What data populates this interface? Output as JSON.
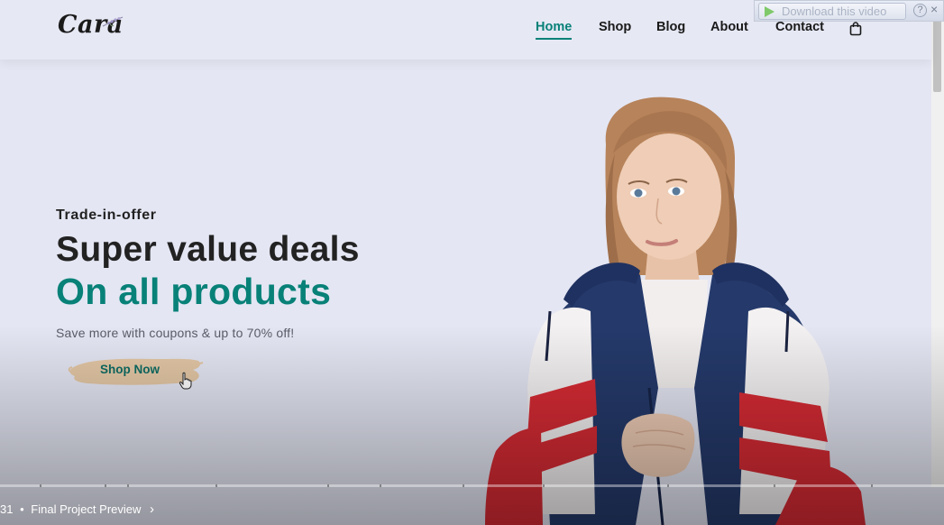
{
  "logo": {
    "text": "Cara"
  },
  "nav": {
    "items": [
      {
        "label": "Home",
        "active": true
      },
      {
        "label": "Shop"
      },
      {
        "label": "Blog"
      },
      {
        "label": "About"
      },
      {
        "label": "Contact"
      }
    ],
    "cart_icon": "shopping-bag-icon"
  },
  "download_overlay": {
    "label": "Download this video",
    "help": "?",
    "close": "×"
  },
  "hero": {
    "kicker": "Trade-in-offer",
    "title_line1": "Super value deals",
    "title_line2": "On all products",
    "subtitle": "Save more with coupons & up to 70% off!",
    "cta_label": "Shop Now"
  },
  "video": {
    "chapter_time": "31",
    "chapter_separator": "•",
    "chapter_title": "Final Project Preview",
    "chapter_chevron": "›"
  },
  "colors": {
    "accent": "#088178",
    "page_bg": "#e4e6f3",
    "button_brush": "#e5c9a8",
    "text_dark": "#222222"
  }
}
